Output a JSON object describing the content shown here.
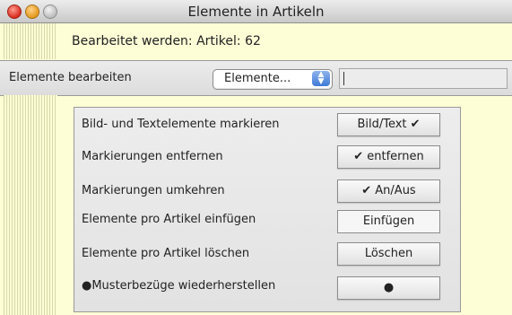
{
  "window": {
    "title": "Elemente in Artikeln"
  },
  "header": {
    "edited_label": "Bearbeitet werden: Artikel: 62"
  },
  "edit_bar": {
    "label": "Elemente bearbeiten",
    "popup_value": "Elemente...",
    "stepper_glyph": "▲▼",
    "text_value": ""
  },
  "actions": [
    {
      "label": "Bild- und Textelemente markieren",
      "button": "Bild/Text ✔"
    },
    {
      "label": "Markierungen entfernen",
      "button": "✔ entfernen"
    },
    {
      "label": "Markierungen umkehren",
      "button": "✔ An/Aus"
    },
    {
      "label": "Elemente pro Artikel einfügen",
      "button": "Einfügen"
    },
    {
      "label": "Elemente pro Artikel löschen",
      "button": "Löschen"
    },
    {
      "label": "●Musterbezüge wiederherstellen",
      "button": "●"
    }
  ]
}
